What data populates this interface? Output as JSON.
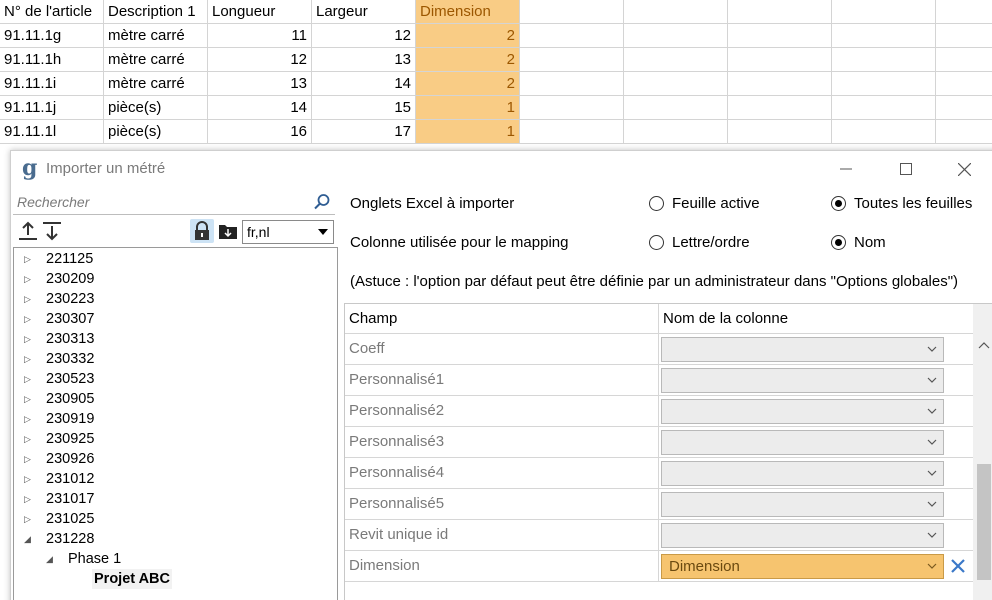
{
  "sheet": {
    "headers": [
      "N° de l'article",
      "Description 1",
      "Longueur",
      "Largeur",
      "Dimension"
    ],
    "rows": [
      {
        "article": "91.11.1g",
        "desc": "mètre carré",
        "longueur": "11",
        "largeur": "12",
        "dimension": "2"
      },
      {
        "article": "91.11.1h",
        "desc": "mètre carré",
        "longueur": "12",
        "largeur": "13",
        "dimension": "2"
      },
      {
        "article": "91.11.1i",
        "desc": "mètre carré",
        "longueur": "13",
        "largeur": "14",
        "dimension": "2"
      },
      {
        "article": "91.11.1j",
        "desc": "pièce(s)",
        "longueur": "14",
        "largeur": "15",
        "dimension": "1"
      },
      {
        "article": "91.11.1l",
        "desc": "pièce(s)",
        "longueur": "16",
        "largeur": "17",
        "dimension": "1"
      }
    ],
    "highlight_color": "#f9cc85"
  },
  "dialog": {
    "logo": "g",
    "title": "Importer un métré",
    "window_buttons": {
      "minimize": "—",
      "maximize": "☐",
      "close": "✕"
    }
  },
  "left": {
    "search_placeholder": "Rechercher",
    "language": "fr,nl",
    "tree": [
      {
        "label": "221125",
        "expanded": false
      },
      {
        "label": "230209",
        "expanded": false
      },
      {
        "label": "230223",
        "expanded": false
      },
      {
        "label": "230307",
        "expanded": false
      },
      {
        "label": "230313",
        "expanded": false
      },
      {
        "label": "230332",
        "expanded": false
      },
      {
        "label": "230523",
        "expanded": false
      },
      {
        "label": "230905",
        "expanded": false
      },
      {
        "label": "230919",
        "expanded": false
      },
      {
        "label": "230925",
        "expanded": false
      },
      {
        "label": "230926",
        "expanded": false
      },
      {
        "label": "231012",
        "expanded": false
      },
      {
        "label": "231017",
        "expanded": false
      },
      {
        "label": "231025",
        "expanded": false
      },
      {
        "label": "231228",
        "expanded": true
      },
      {
        "label": "Phase 1",
        "expanded": true,
        "level": 1
      },
      {
        "label": "Projet ABC",
        "level": 2,
        "selected": true
      }
    ]
  },
  "options": {
    "tabs_label": "Onglets Excel à importer",
    "tabs_choice_active": "Feuille active",
    "tabs_choice_all": "Toutes les feuilles",
    "tabs_selected": "all",
    "mapping_label": "Colonne utilisée pour le mapping",
    "mapping_choice_letter": "Lettre/ordre",
    "mapping_choice_name": "Nom",
    "mapping_selected": "name",
    "hint": "(Astuce : l'option par défaut peut être définie par un administrateur dans \"Options globales\")"
  },
  "grid": {
    "header_field": "Champ",
    "header_column": "Nom de la colonne",
    "rows": [
      {
        "field": "Coeff",
        "value": ""
      },
      {
        "field": "Personnalisé1",
        "value": ""
      },
      {
        "field": "Personnalisé2",
        "value": ""
      },
      {
        "field": "Personnalisé3",
        "value": ""
      },
      {
        "field": "Personnalisé4",
        "value": ""
      },
      {
        "field": "Personnalisé5",
        "value": ""
      },
      {
        "field": "Revit unique id",
        "value": ""
      },
      {
        "field": "Dimension",
        "value": "Dimension"
      }
    ],
    "filled_color": "#f6c46f"
  }
}
